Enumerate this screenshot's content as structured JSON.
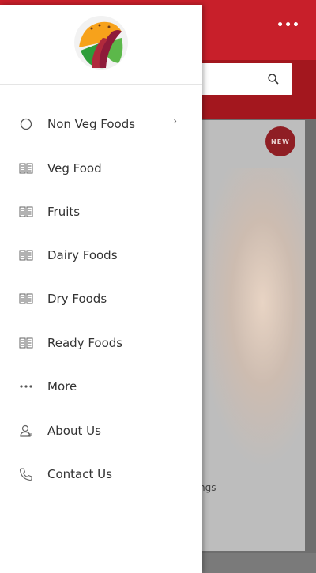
{
  "header": {
    "more_label": "•••",
    "search": {
      "icon": "search-icon"
    }
  },
  "product_card": {
    "badge": "NEW",
    "partial_text": "ngs"
  },
  "drawer": {
    "logo": "brand-logo",
    "menu": [
      {
        "label": "Non Veg Foods",
        "icon": "circle-icon",
        "has_submenu": true
      },
      {
        "label": "Veg Food",
        "icon": "book-icon"
      },
      {
        "label": "Fruits",
        "icon": "book-icon"
      },
      {
        "label": "Dairy Foods",
        "icon": "book-icon"
      },
      {
        "label": "Dry Foods",
        "icon": "book-icon"
      },
      {
        "label": "Ready Foods",
        "icon": "book-icon"
      },
      {
        "label": "More",
        "icon": "ellipsis-icon"
      },
      {
        "label": "About Us",
        "icon": "user-icon"
      },
      {
        "label": "Contact Us",
        "icon": "phone-icon"
      }
    ],
    "submenu_indicator": "›"
  },
  "colors": {
    "header_red": "#c81f2a",
    "header_dark_red": "#a3171e",
    "badge": "#8f1e24",
    "drawer_bg": "#ffffff",
    "text": "#333333"
  }
}
